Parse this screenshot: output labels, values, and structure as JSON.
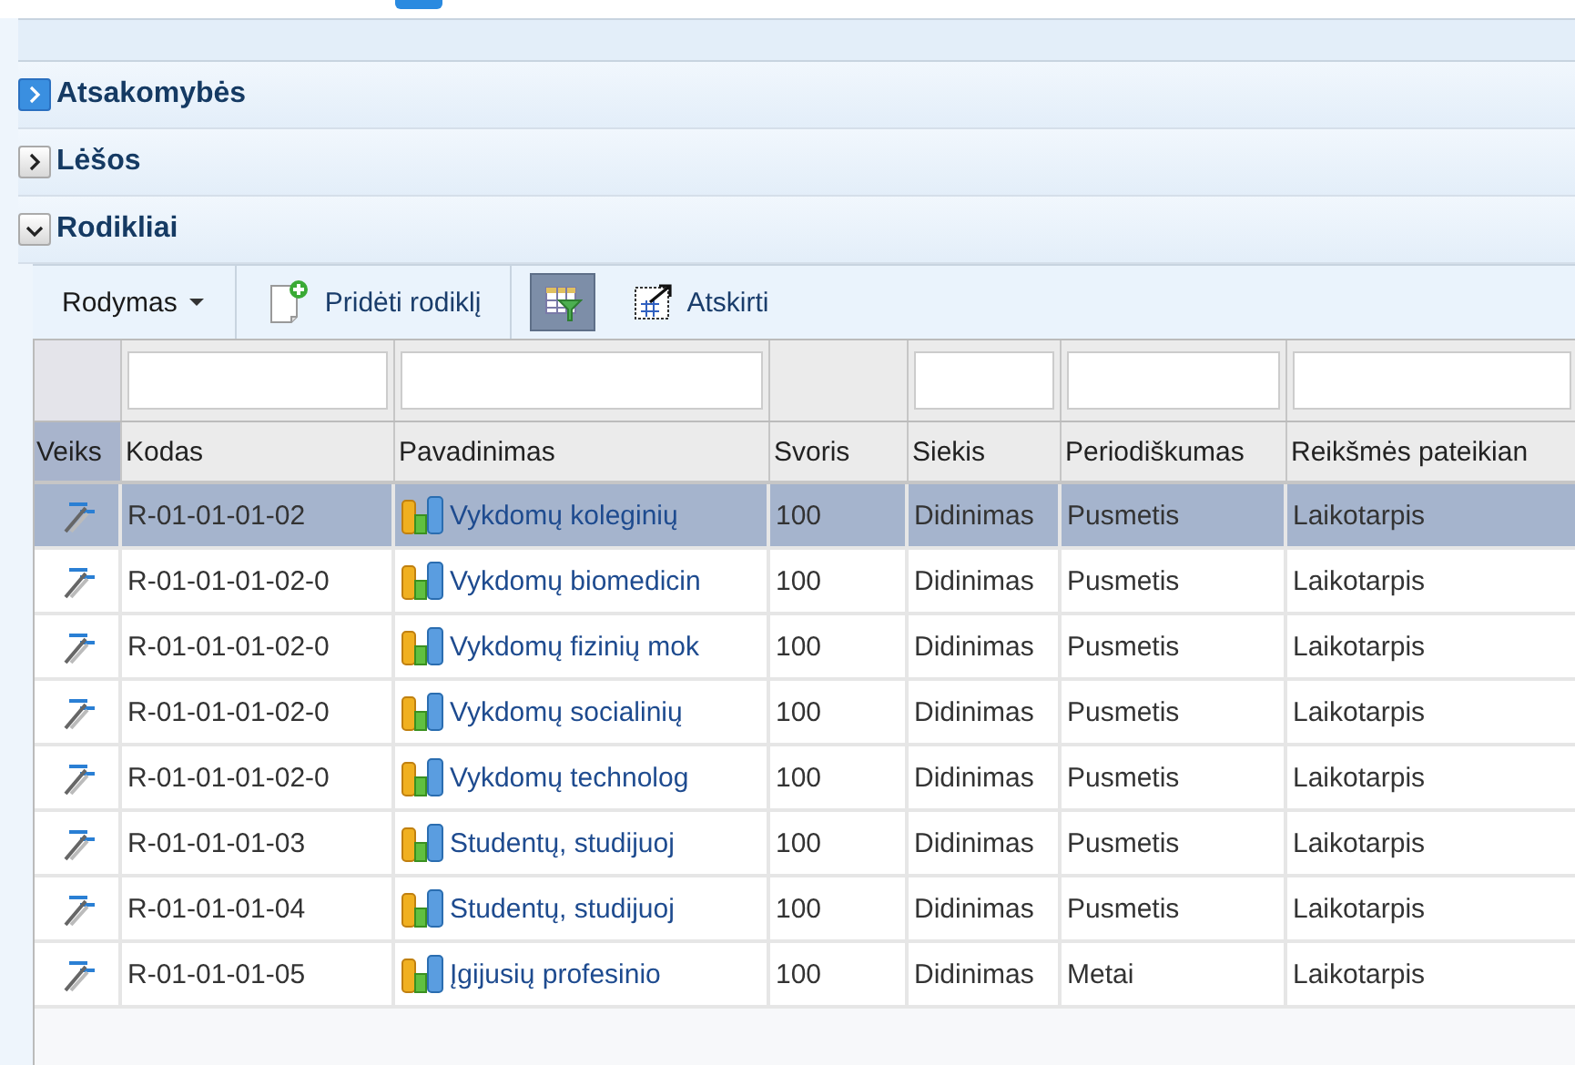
{
  "sections": [
    {
      "title": "Atsakomybės",
      "expanded": false,
      "hovered": true
    },
    {
      "title": "Lėšos",
      "expanded": false,
      "hovered": false
    },
    {
      "title": "Rodikliai",
      "expanded": true,
      "hovered": false
    }
  ],
  "toolbar": {
    "items": [
      {
        "kind": "dropdown",
        "label": "Rodymas"
      },
      {
        "kind": "add",
        "label": "Pridėti rodiklį"
      },
      {
        "kind": "filter",
        "pressed": true
      },
      {
        "kind": "detach",
        "label": "Atskirti"
      }
    ]
  },
  "table": {
    "columns": [
      "Veiks",
      "Kodas",
      "Pavadinimas",
      "Svoris",
      "Siekis",
      "Periodiškumas",
      "Reikšmės pateikian"
    ],
    "rows": [
      {
        "selected": true,
        "code": "R-01-01-01-02",
        "name": "Vykdomų koleginių",
        "weight": "100",
        "goal": "Didinimas",
        "period": "Pusmetis",
        "submission": "Laikotarpis"
      },
      {
        "selected": false,
        "code": "R-01-01-01-02-0",
        "name": "Vykdomų biomedicin",
        "weight": "100",
        "goal": "Didinimas",
        "period": "Pusmetis",
        "submission": "Laikotarpis"
      },
      {
        "selected": false,
        "code": "R-01-01-01-02-0",
        "name": "Vykdomų fizinių mok",
        "weight": "100",
        "goal": "Didinimas",
        "period": "Pusmetis",
        "submission": "Laikotarpis"
      },
      {
        "selected": false,
        "code": "R-01-01-01-02-0",
        "name": "Vykdomų socialinių",
        "weight": "100",
        "goal": "Didinimas",
        "period": "Pusmetis",
        "submission": "Laikotarpis"
      },
      {
        "selected": false,
        "code": "R-01-01-01-02-0",
        "name": "Vykdomų technolog",
        "weight": "100",
        "goal": "Didinimas",
        "period": "Pusmetis",
        "submission": "Laikotarpis"
      },
      {
        "selected": false,
        "code": "R-01-01-01-03",
        "name": "Studentų, studijuoj",
        "weight": "100",
        "goal": "Didinimas",
        "period": "Pusmetis",
        "submission": "Laikotarpis"
      },
      {
        "selected": false,
        "code": "R-01-01-01-04",
        "name": "Studentų, studijuoj",
        "weight": "100",
        "goal": "Didinimas",
        "period": "Pusmetis",
        "submission": "Laikotarpis"
      },
      {
        "selected": false,
        "code": "R-01-01-01-05",
        "name": "Įgijusių profesinio",
        "weight": "100",
        "goal": "Didinimas",
        "period": "Metai",
        "submission": "Laikotarpis"
      }
    ]
  }
}
